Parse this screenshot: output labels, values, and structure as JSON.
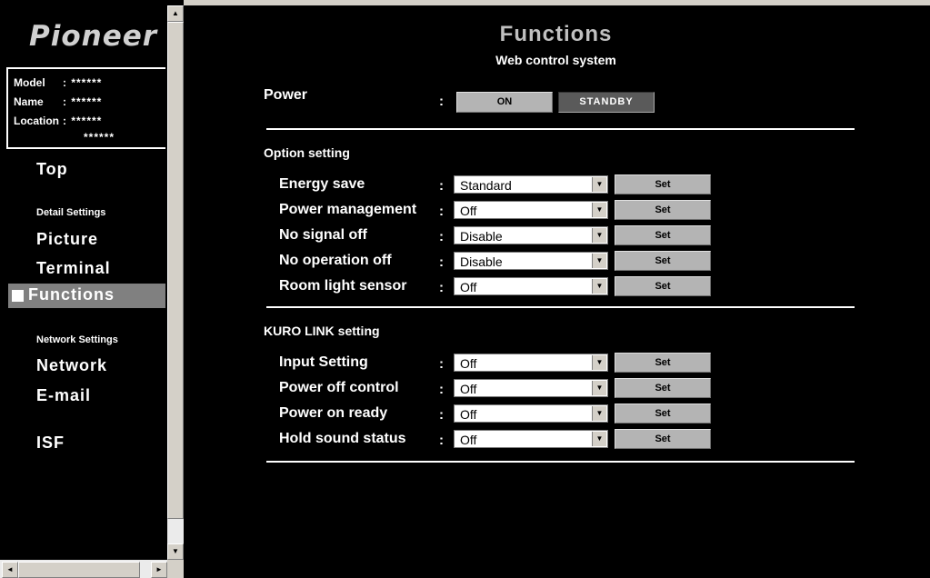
{
  "sidebar": {
    "logo": "Pioneer",
    "info": [
      {
        "key": "Model",
        "value": ": ******"
      },
      {
        "key": "Name",
        "value": ": ******"
      },
      {
        "key": "Location",
        "value": ": ******"
      },
      {
        "key": "",
        "value": "******"
      }
    ],
    "nav": {
      "top": "Top",
      "detail_heading": "Detail Settings",
      "picture": "Picture",
      "terminal": "Terminal",
      "functions": "Functions",
      "network_heading": "Network Settings",
      "network": "Network",
      "email": "E-mail",
      "isf": "ISF"
    },
    "scroll_up": "▲",
    "scroll_down": "▼",
    "scroll_left": "◄",
    "scroll_right": "►"
  },
  "page": {
    "title": "Functions",
    "subtitle": "Web control system"
  },
  "power": {
    "label": "Power",
    "colon": ":",
    "on_label": "ON",
    "standby_label": "STANDBY"
  },
  "option": {
    "heading": "Option setting",
    "rows": [
      {
        "label": "Energy save",
        "value": "Standard",
        "set": "Set"
      },
      {
        "label": "Power management",
        "value": "Off",
        "set": "Set"
      },
      {
        "label": "No signal off",
        "value": "Disable",
        "set": "Set"
      },
      {
        "label": "No operation off",
        "value": "Disable",
        "set": "Set"
      },
      {
        "label": "Room light sensor",
        "value": "Off",
        "set": "Set"
      }
    ]
  },
  "kuro": {
    "heading": "KURO LINK setting",
    "rows": [
      {
        "label": "Input Setting",
        "value": "Off",
        "set": "Set"
      },
      {
        "label": "Power off control",
        "value": "Off",
        "set": "Set"
      },
      {
        "label": "Power on ready",
        "value": "Off",
        "set": "Set"
      },
      {
        "label": "Hold sound status",
        "value": "Off",
        "set": "Set"
      }
    ]
  },
  "colon": ":",
  "dropdown_arrow": "▼",
  "colors": {
    "background": "#000000",
    "button": "#b4b4b4",
    "active_nav": "#808080",
    "standby_button": "#5a5a5a"
  }
}
